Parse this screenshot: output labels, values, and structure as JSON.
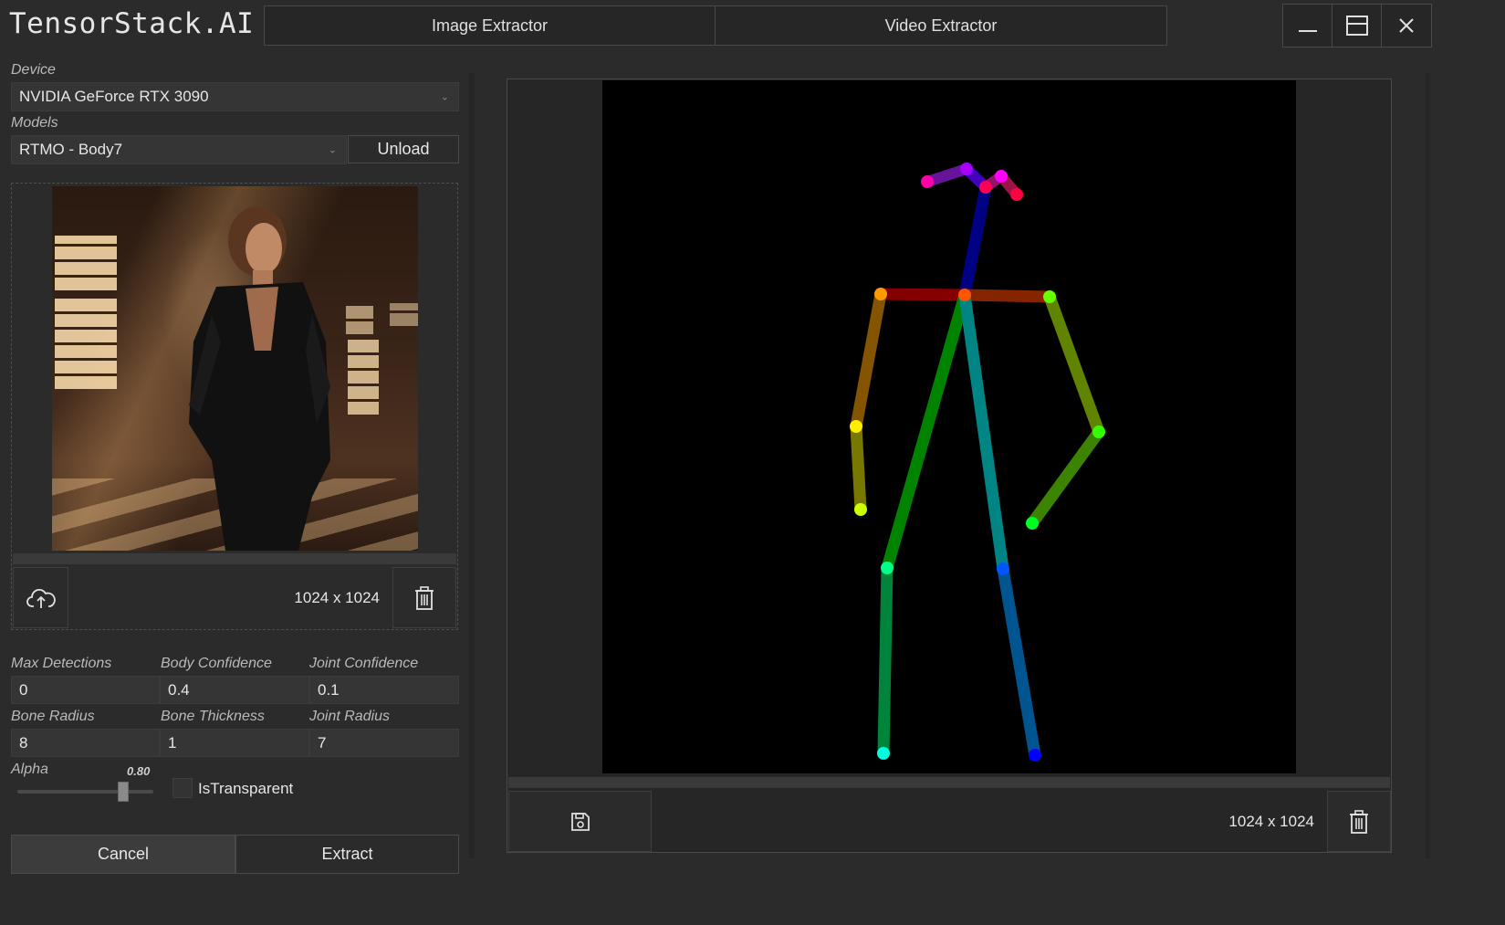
{
  "app": {
    "title": "TensorStack.AI"
  },
  "tabs": [
    {
      "label": "Image Extractor"
    },
    {
      "label": "Video Extractor"
    }
  ],
  "window_controls": [
    "minimize-icon",
    "maximize-icon",
    "close-icon"
  ],
  "device": {
    "label": "Device",
    "value": "NVIDIA GeForce RTX 3090"
  },
  "models": {
    "label": "Models",
    "value": "RTMO - Body7",
    "unload_label": "Unload"
  },
  "input_image": {
    "dimensions": "1024 x 1024",
    "upload_icon": "cloud-upload-icon",
    "delete_icon": "trash-icon"
  },
  "settings": {
    "max_detections": {
      "label": "Max Detections",
      "value": "0"
    },
    "body_confidence": {
      "label": "Body Confidence",
      "value": "0.4"
    },
    "joint_confidence": {
      "label": "Joint Confidence",
      "value": "0.1"
    },
    "bone_radius": {
      "label": "Bone Radius",
      "value": "8"
    },
    "bone_thickness": {
      "label": "Bone Thickness",
      "value": "1"
    },
    "joint_radius": {
      "label": "Joint Radius",
      "value": "7"
    },
    "alpha": {
      "label": "Alpha",
      "value_text": "0.80",
      "value": 0.8
    },
    "is_transparent": {
      "label": "IsTransparent",
      "checked": false
    }
  },
  "actions": {
    "cancel_label": "Cancel",
    "extract_label": "Extract"
  },
  "output_image": {
    "dimensions": "1024 x 1024",
    "save_icon": "save-icon",
    "delete_icon": "trash-icon"
  },
  "colors": {
    "background": "#2b2b2b",
    "panel": "#262626",
    "field": "#353535",
    "border": "#4a4a4a"
  }
}
